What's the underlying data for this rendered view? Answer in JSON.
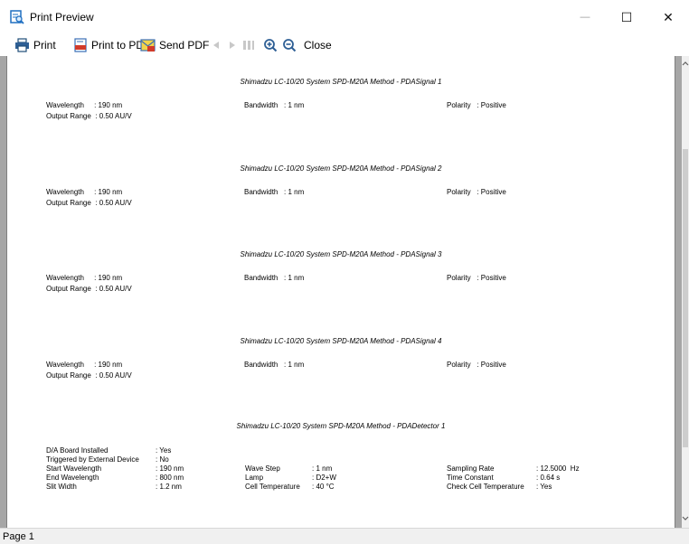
{
  "window": {
    "title": "Print Preview",
    "minimize_glyph": "—",
    "maximize_glyph": "☐",
    "close_glyph": "✕"
  },
  "toolbar": {
    "print_label": "Print",
    "print_pdf_label": "Print to PDF",
    "send_pdf_label": "Send PDF",
    "close_label": "Close"
  },
  "document": {
    "sections": [
      {
        "title": "Shimadzu LC-10/20 System SPD-M20A Method - PDASignal 1",
        "wavelength": "Wavelength     : 190 nm",
        "output_range": "Output Range  : 0.50 AU/V",
        "bandwidth": "Bandwidth   : 1 nm",
        "polarity": "Polarity   : Positive"
      },
      {
        "title": "Shimadzu LC-10/20 System SPD-M20A Method - PDASignal 2",
        "wavelength": "Wavelength     : 190 nm",
        "output_range": "Output Range  : 0.50 AU/V",
        "bandwidth": "Bandwidth   : 1 nm",
        "polarity": "Polarity   : Positive"
      },
      {
        "title": "Shimadzu LC-10/20 System SPD-M20A Method - PDASignal 3",
        "wavelength": "Wavelength     : 190 nm",
        "output_range": "Output Range  : 0.50 AU/V",
        "bandwidth": "Bandwidth   : 1 nm",
        "polarity": "Polarity   : Positive"
      },
      {
        "title": "Shimadzu LC-10/20 System SPD-M20A Method - PDASignal 4",
        "wavelength": "Wavelength     : 190 nm",
        "output_range": "Output Range  : 0.50 AU/V",
        "bandwidth": "Bandwidth   : 1 nm",
        "polarity": "Polarity   : Positive"
      }
    ],
    "detector": {
      "title": "Shimadzu LC-10/20 System SPD-M20A Method - PDADetector 1",
      "col1_labels": [
        "D/A Board Installed",
        "Triggered by External Device",
        "Start Wavelength",
        "End Wavelength",
        "Slit Width"
      ],
      "col1_values": [
        ": Yes",
        ": No",
        ": 190 nm",
        ": 800 nm",
        ": 1.2 nm"
      ],
      "col2_labels": [
        "Wave Step",
        "Lamp",
        "Cell Temperature"
      ],
      "col2_values": [
        ": 1 nm",
        ": D2+W",
        ": 40 °C"
      ],
      "col3_labels": [
        "Sampling Rate",
        "Time Constant",
        "Check Cell Temperature"
      ],
      "col3_values": [
        ": 12.5000  Hz",
        ": 0.64 s",
        ": Yes"
      ]
    }
  },
  "status": {
    "page_label": "Page 1"
  }
}
